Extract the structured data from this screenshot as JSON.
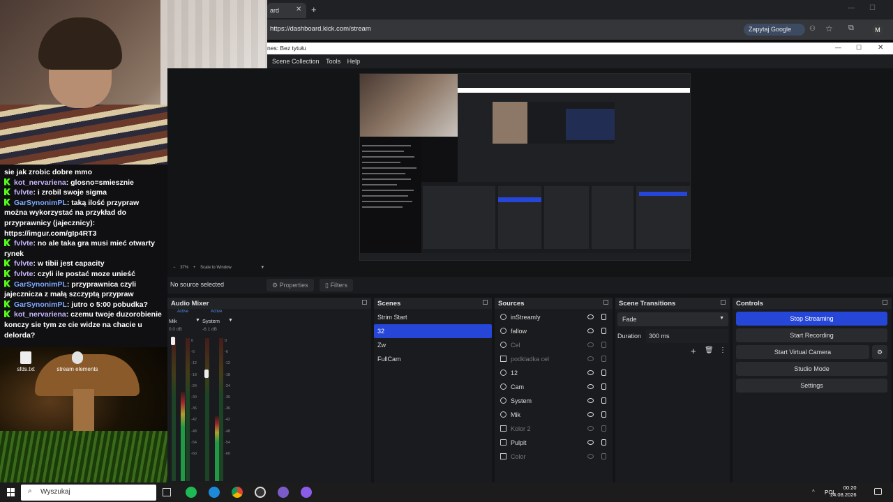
{
  "browser": {
    "tab_title": "ard",
    "url": "https://dashboard.kick.com/stream",
    "google_button": "Zapytaj Google",
    "profile_initial": "M"
  },
  "obs": {
    "window_title": "nes: Bez tytułu",
    "menu": [
      "Scene Collection",
      "Tools",
      "Help"
    ],
    "zoom": "37%",
    "scale_mode": "Scale to Window",
    "no_source": "No source selected",
    "properties_label": "Properties",
    "filters_label": "Filters",
    "audio_mixer": {
      "title": "Audio Mixer",
      "channels": [
        {
          "status": "Active",
          "name": "Mik",
          "db": "0.0 dB"
        },
        {
          "status": "Active",
          "name": "System",
          "db": "-6.1 dB"
        }
      ],
      "scale": [
        "0",
        "-6",
        "-12",
        "-18",
        "-24",
        "-30",
        "-36",
        "-42",
        "-48",
        "-54",
        "-60"
      ]
    },
    "scenes": {
      "title": "Scenes",
      "items": [
        "Strim Start",
        "32",
        "Zw",
        "FullCam"
      ],
      "selected": "32"
    },
    "sources": {
      "title": "Sources",
      "items": [
        {
          "name": "inStreamly",
          "visible": true
        },
        {
          "name": "fallow",
          "visible": true
        },
        {
          "name": "Cel",
          "visible": false
        },
        {
          "name": "podkladka cel",
          "visible": false
        },
        {
          "name": "12",
          "visible": true
        },
        {
          "name": "Cam",
          "visible": true
        },
        {
          "name": "System",
          "visible": true
        },
        {
          "name": "Mik",
          "visible": true
        },
        {
          "name": "Kolor 2",
          "visible": false
        },
        {
          "name": "Pulpit",
          "visible": true
        },
        {
          "name": "Color",
          "visible": false
        }
      ]
    },
    "transitions": {
      "title": "Scene Transitions",
      "selected": "Fade",
      "duration_label": "Duration",
      "duration_value": "300 ms"
    },
    "controls": {
      "title": "Controls",
      "stop_streaming": "Stop Streaming",
      "start_recording": "Start Recording",
      "start_virtual_camera": "Start Virtual Camera",
      "studio_mode": "Studio Mode",
      "settings": "Settings"
    }
  },
  "chat": {
    "messages": [
      {
        "user": "",
        "text": "sie jak zrobic dobre mmo"
      },
      {
        "user": "kot_nervariena",
        "text": "glosno=smiesznie"
      },
      {
        "user": "fvlvte",
        "text": "i zrobil swoje sigma"
      },
      {
        "user": "GarSynonimPL",
        "text": "taką ilość przypraw można wykorzystać na przykład do przyprawnicy (jajecznicy): https://imgur.com/gIp4RT3"
      },
      {
        "user": "fvlvte",
        "text": "no ale taka gra musi mieć otwarty rynek"
      },
      {
        "user": "fvlvte",
        "text": "w tibii jest capacity"
      },
      {
        "user": "fvlvte",
        "text": "czyli ile postać moze unieść"
      },
      {
        "user": "GarSynonimPL",
        "text": "przyprawnica czyli jajecznicza z małą szczyptą przypraw"
      },
      {
        "user": "GarSynonimPL",
        "text": "jutro o 5:00 pobudka?"
      },
      {
        "user": "kot_nervariena",
        "text": "czemu twoje duzorobienie konczy sie tym ze cie widze na chacie u delorda?"
      }
    ]
  },
  "desktop": {
    "icons": [
      "sfds.txt",
      "stream elements"
    ]
  },
  "taskbar": {
    "search_placeholder": "Wyszukaj",
    "language": "POL",
    "time": "00:20",
    "date": "24.08.2026"
  }
}
